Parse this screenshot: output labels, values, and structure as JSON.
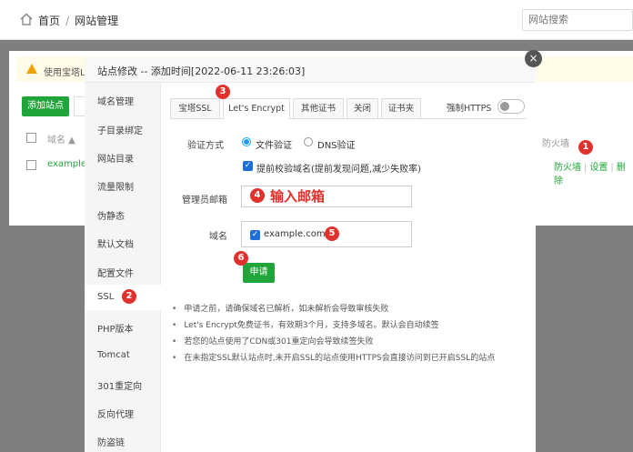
{
  "breadcrumb": {
    "home": "首页",
    "separator": "/",
    "current": "网站管理"
  },
  "site_search": {
    "placeholder": "网站搜索"
  },
  "background": {
    "warning_text": "使用宝塔L",
    "add_site_button": "添加站点",
    "table": {
      "col_domain": "域名 ▲",
      "row_domain": "example.",
      "col_firewall": "防火墙",
      "row_actions": [
        "防火墙",
        "设置",
        "删除"
      ],
      "action_separator": "|"
    }
  },
  "modal": {
    "title": "站点修改 -- 添加时间[2022-06-11 23:26:03]",
    "close_icon": "×",
    "side_menu": [
      "域名管理",
      "子目录绑定",
      "网站目录",
      "流量限制",
      "伪静态",
      "默认文档",
      "配置文件",
      "SSL",
      "PHP版本",
      "Tomcat",
      "301重定向",
      "反向代理",
      "防盗链"
    ],
    "active_side_item": "SSL",
    "tabs": [
      "宝塔SSL",
      "Let's Encrypt",
      "其他证书",
      "关闭",
      "证书夹"
    ],
    "active_tab": "Let's Encrypt",
    "force_https_label": "强制HTTPS",
    "force_https_on": false,
    "verify": {
      "label": "验证方式",
      "option_file": "文件验证",
      "option_dns": "DNS验证",
      "selected": "文件验证",
      "precheck_label": "提前校验域名(提前发现问题,减少失败率)",
      "precheck_checked": true
    },
    "admin_email": {
      "label": "管理员邮箱",
      "value": ""
    },
    "domain": {
      "label": "域名",
      "item": "example.com",
      "checked": true
    },
    "apply_button": "申请",
    "notes": [
      "申请之前，请确保域名已解析，如未解析会导致审核失败",
      "Let's Encrypt免费证书，有效期3个月，支持多域名。默认会自动续签",
      "若您的站点使用了CDN或301重定向会导致续签失败",
      "在未指定SSL默认站点时,未开启SSL的站点使用HTTPS会直接访问到已开启SSL的站点"
    ]
  },
  "annotations": {
    "markers": [
      "1",
      "2",
      "3",
      "4",
      "5",
      "6"
    ],
    "email_hint": "输入邮箱",
    "marker_color": "#e0312c"
  },
  "colors": {
    "brand_green": "#20a53a",
    "link_blue": "#1e9fff",
    "checkbox_blue": "#1e6fd9"
  }
}
